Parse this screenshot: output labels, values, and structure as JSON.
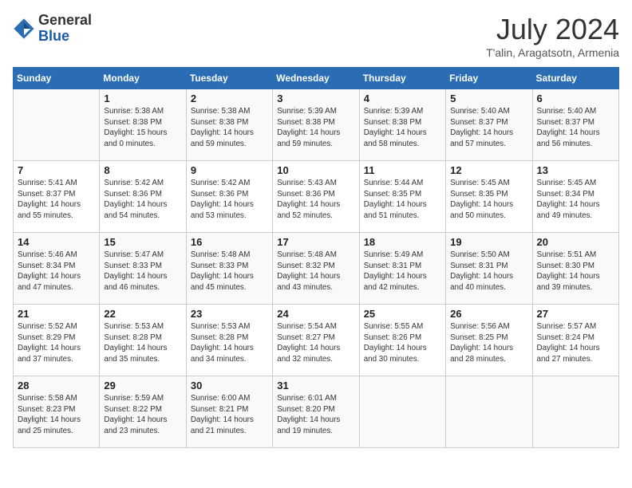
{
  "header": {
    "logo_line1": "General",
    "logo_line2": "Blue",
    "month_title": "July 2024",
    "subtitle": "T'alin, Aragatsotn, Armenia"
  },
  "weekdays": [
    "Sunday",
    "Monday",
    "Tuesday",
    "Wednesday",
    "Thursday",
    "Friday",
    "Saturday"
  ],
  "weeks": [
    [
      {
        "day": "",
        "info": ""
      },
      {
        "day": "1",
        "info": "Sunrise: 5:38 AM\nSunset: 8:38 PM\nDaylight: 15 hours\nand 0 minutes."
      },
      {
        "day": "2",
        "info": "Sunrise: 5:38 AM\nSunset: 8:38 PM\nDaylight: 14 hours\nand 59 minutes."
      },
      {
        "day": "3",
        "info": "Sunrise: 5:39 AM\nSunset: 8:38 PM\nDaylight: 14 hours\nand 59 minutes."
      },
      {
        "day": "4",
        "info": "Sunrise: 5:39 AM\nSunset: 8:38 PM\nDaylight: 14 hours\nand 58 minutes."
      },
      {
        "day": "5",
        "info": "Sunrise: 5:40 AM\nSunset: 8:37 PM\nDaylight: 14 hours\nand 57 minutes."
      },
      {
        "day": "6",
        "info": "Sunrise: 5:40 AM\nSunset: 8:37 PM\nDaylight: 14 hours\nand 56 minutes."
      }
    ],
    [
      {
        "day": "7",
        "info": "Sunrise: 5:41 AM\nSunset: 8:37 PM\nDaylight: 14 hours\nand 55 minutes."
      },
      {
        "day": "8",
        "info": "Sunrise: 5:42 AM\nSunset: 8:36 PM\nDaylight: 14 hours\nand 54 minutes."
      },
      {
        "day": "9",
        "info": "Sunrise: 5:42 AM\nSunset: 8:36 PM\nDaylight: 14 hours\nand 53 minutes."
      },
      {
        "day": "10",
        "info": "Sunrise: 5:43 AM\nSunset: 8:36 PM\nDaylight: 14 hours\nand 52 minutes."
      },
      {
        "day": "11",
        "info": "Sunrise: 5:44 AM\nSunset: 8:35 PM\nDaylight: 14 hours\nand 51 minutes."
      },
      {
        "day": "12",
        "info": "Sunrise: 5:45 AM\nSunset: 8:35 PM\nDaylight: 14 hours\nand 50 minutes."
      },
      {
        "day": "13",
        "info": "Sunrise: 5:45 AM\nSunset: 8:34 PM\nDaylight: 14 hours\nand 49 minutes."
      }
    ],
    [
      {
        "day": "14",
        "info": "Sunrise: 5:46 AM\nSunset: 8:34 PM\nDaylight: 14 hours\nand 47 minutes."
      },
      {
        "day": "15",
        "info": "Sunrise: 5:47 AM\nSunset: 8:33 PM\nDaylight: 14 hours\nand 46 minutes."
      },
      {
        "day": "16",
        "info": "Sunrise: 5:48 AM\nSunset: 8:33 PM\nDaylight: 14 hours\nand 45 minutes."
      },
      {
        "day": "17",
        "info": "Sunrise: 5:48 AM\nSunset: 8:32 PM\nDaylight: 14 hours\nand 43 minutes."
      },
      {
        "day": "18",
        "info": "Sunrise: 5:49 AM\nSunset: 8:31 PM\nDaylight: 14 hours\nand 42 minutes."
      },
      {
        "day": "19",
        "info": "Sunrise: 5:50 AM\nSunset: 8:31 PM\nDaylight: 14 hours\nand 40 minutes."
      },
      {
        "day": "20",
        "info": "Sunrise: 5:51 AM\nSunset: 8:30 PM\nDaylight: 14 hours\nand 39 minutes."
      }
    ],
    [
      {
        "day": "21",
        "info": "Sunrise: 5:52 AM\nSunset: 8:29 PM\nDaylight: 14 hours\nand 37 minutes."
      },
      {
        "day": "22",
        "info": "Sunrise: 5:53 AM\nSunset: 8:28 PM\nDaylight: 14 hours\nand 35 minutes."
      },
      {
        "day": "23",
        "info": "Sunrise: 5:53 AM\nSunset: 8:28 PM\nDaylight: 14 hours\nand 34 minutes."
      },
      {
        "day": "24",
        "info": "Sunrise: 5:54 AM\nSunset: 8:27 PM\nDaylight: 14 hours\nand 32 minutes."
      },
      {
        "day": "25",
        "info": "Sunrise: 5:55 AM\nSunset: 8:26 PM\nDaylight: 14 hours\nand 30 minutes."
      },
      {
        "day": "26",
        "info": "Sunrise: 5:56 AM\nSunset: 8:25 PM\nDaylight: 14 hours\nand 28 minutes."
      },
      {
        "day": "27",
        "info": "Sunrise: 5:57 AM\nSunset: 8:24 PM\nDaylight: 14 hours\nand 27 minutes."
      }
    ],
    [
      {
        "day": "28",
        "info": "Sunrise: 5:58 AM\nSunset: 8:23 PM\nDaylight: 14 hours\nand 25 minutes."
      },
      {
        "day": "29",
        "info": "Sunrise: 5:59 AM\nSunset: 8:22 PM\nDaylight: 14 hours\nand 23 minutes."
      },
      {
        "day": "30",
        "info": "Sunrise: 6:00 AM\nSunset: 8:21 PM\nDaylight: 14 hours\nand 21 minutes."
      },
      {
        "day": "31",
        "info": "Sunrise: 6:01 AM\nSunset: 8:20 PM\nDaylight: 14 hours\nand 19 minutes."
      },
      {
        "day": "",
        "info": ""
      },
      {
        "day": "",
        "info": ""
      },
      {
        "day": "",
        "info": ""
      }
    ]
  ]
}
